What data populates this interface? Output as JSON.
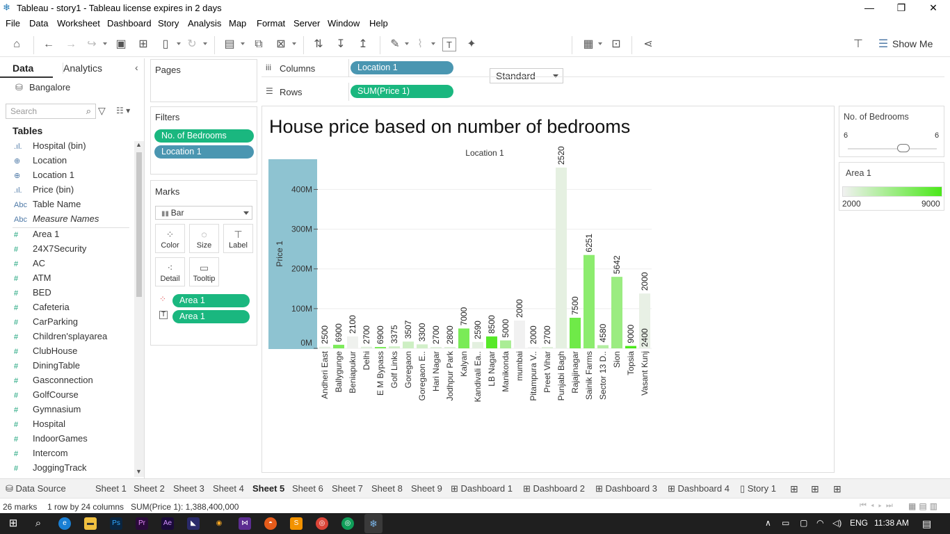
{
  "window": {
    "title": "Tableau - story1 - Tableau license expires in 2 days",
    "controls": [
      "—",
      "❐",
      "✕"
    ]
  },
  "menu": [
    "File",
    "Data",
    "Worksheet",
    "Dashboard",
    "Story",
    "Analysis",
    "Map",
    "Format",
    "Server",
    "Window",
    "Help"
  ],
  "toolbar": {
    "fit_mode": "Standard",
    "show_me": "Show Me"
  },
  "left_pane": {
    "tabs": [
      "Data",
      "Analytics"
    ],
    "datasource": "Bangalore",
    "search_placeholder": "Search",
    "tables_heading": "Tables",
    "fields": [
      {
        "icon": ".ıl.",
        "name": "Hospital (bin)",
        "type": "dim"
      },
      {
        "icon": "⊕",
        "name": "Location",
        "type": "dim"
      },
      {
        "icon": "⊕",
        "name": "Location 1",
        "type": "dim"
      },
      {
        "icon": ".ıl.",
        "name": "Price (bin)",
        "type": "dim"
      },
      {
        "icon": "Abc",
        "name": "Table Name",
        "type": "dim"
      },
      {
        "icon": "Abc",
        "name": "Measure Names",
        "type": "dim"
      },
      {
        "icon": "#",
        "name": "Area 1",
        "type": "meas"
      },
      {
        "icon": "#",
        "name": "24X7Security",
        "type": "meas"
      },
      {
        "icon": "#",
        "name": "AC",
        "type": "meas"
      },
      {
        "icon": "#",
        "name": "ATM",
        "type": "meas"
      },
      {
        "icon": "#",
        "name": "BED",
        "type": "meas"
      },
      {
        "icon": "#",
        "name": "Cafeteria",
        "type": "meas"
      },
      {
        "icon": "#",
        "name": "CarParking",
        "type": "meas"
      },
      {
        "icon": "#",
        "name": "Children'splayarea",
        "type": "meas"
      },
      {
        "icon": "#",
        "name": "ClubHouse",
        "type": "meas"
      },
      {
        "icon": "#",
        "name": "DiningTable",
        "type": "meas"
      },
      {
        "icon": "#",
        "name": "Gasconnection",
        "type": "meas"
      },
      {
        "icon": "#",
        "name": "GolfCourse",
        "type": "meas"
      },
      {
        "icon": "#",
        "name": "Gymnasium",
        "type": "meas"
      },
      {
        "icon": "#",
        "name": "Hospital",
        "type": "meas"
      },
      {
        "icon": "#",
        "name": "IndoorGames",
        "type": "meas"
      },
      {
        "icon": "#",
        "name": "Intercom",
        "type": "meas"
      },
      {
        "icon": "#",
        "name": "JoggingTrack",
        "type": "meas"
      }
    ]
  },
  "shelves": {
    "pages": "Pages",
    "filters": "Filters",
    "filter_pills": [
      "No. of Bedrooms",
      "Location 1"
    ],
    "marks": "Marks",
    "mark_type": "Bar",
    "mark_buttons": [
      "Color",
      "Size",
      "Label",
      "Detail",
      "Tooltip"
    ],
    "mark_pills": [
      "Area 1",
      "Area 1"
    ],
    "columns_label": "Columns",
    "columns_pill": "Location 1",
    "rows_label": "Rows",
    "rows_pill": "SUM(Price 1)"
  },
  "chart_data": {
    "type": "bar",
    "title": "House price based on number of bedrooms",
    "column_header": "Location 1",
    "ylabel": "Price 1",
    "y_ticks": [
      "0M",
      "100M",
      "200M",
      "300M",
      "400M"
    ],
    "ylim": [
      0,
      455
    ],
    "y_unit": "M",
    "categories": [
      "Andheri East",
      "Ballygunge",
      "Beniapukur",
      "Delhi",
      "E M Bypass",
      "Golf Links",
      "Goregaon",
      "Goregaon E..",
      "Hari Nagar",
      "Jodhpur Park",
      "Kalyan",
      "Kandivali Ea..",
      "LB Nagar",
      "Manikonda",
      "mumbai",
      "Pitampura V..",
      "Preet Vihar",
      "Punjabi Bagh",
      "Rajajinagar",
      "Sainik Farms",
      "Sector 13 D..",
      "Sion",
      "Topsia",
      "Vasant Kunj"
    ],
    "values": [
      4,
      9,
      30,
      4,
      3,
      5,
      17,
      10,
      3,
      2,
      50,
      16,
      30,
      20,
      70,
      3,
      2,
      455,
      77,
      235,
      8,
      180,
      6,
      138
    ],
    "color_values": [
      2500,
      6900,
      2100,
      2700,
      6900,
      3375,
      3507,
      3300,
      2700,
      2800,
      7000,
      2590,
      8500,
      5000,
      2000,
      2000,
      2700,
      2520,
      7500,
      6251,
      4580,
      5642,
      9000,
      2400
    ],
    "labels": [
      [
        "2500"
      ],
      [
        "6900"
      ],
      [
        "2100"
      ],
      [
        "2700"
      ],
      [
        "6900"
      ],
      [
        "3375"
      ],
      [
        "3507"
      ],
      [
        "3300"
      ],
      [
        "2700"
      ],
      [
        "2800"
      ],
      [
        "7000"
      ],
      [
        "2590"
      ],
      [
        "8500"
      ],
      [
        "5000"
      ],
      [
        "2000"
      ],
      [
        "2000"
      ],
      [
        "2700"
      ],
      [
        "2520"
      ],
      [
        "7500"
      ],
      [
        "6251"
      ],
      [
        "4580"
      ],
      [
        "5642"
      ],
      [
        "9000"
      ],
      [
        "2000",
        "2400"
      ]
    ],
    "color_scale": {
      "min": 2000,
      "max": 9000,
      "low_color": "#f1f1f1",
      "high_color": "#4be81a"
    },
    "highlight_color": "#8ec3d1"
  },
  "legends": {
    "slider_title": "No. of Bedrooms",
    "slider_min": "6",
    "slider_max": "6",
    "color_title": "Area 1",
    "color_min": "2000",
    "color_max": "9000"
  },
  "sheet_tabs": [
    "Data Source",
    "Sheet 1",
    "Sheet 2",
    "Sheet 3",
    "Sheet 4",
    "Sheet 5",
    "Sheet 6",
    "Sheet 7",
    "Sheet 8",
    "Sheet 9",
    "Dashboard 1",
    "Dashboard 2",
    "Dashboard 3",
    "Dashboard 4",
    "Story 1"
  ],
  "active_sheet": "Sheet 5",
  "status": {
    "marks": "26 marks",
    "dims": "1 row by 24 columns",
    "sum": "SUM(Price 1): 1,388,400,000"
  },
  "taskbar": {
    "language": "ENG",
    "time": "11:38 AM"
  }
}
